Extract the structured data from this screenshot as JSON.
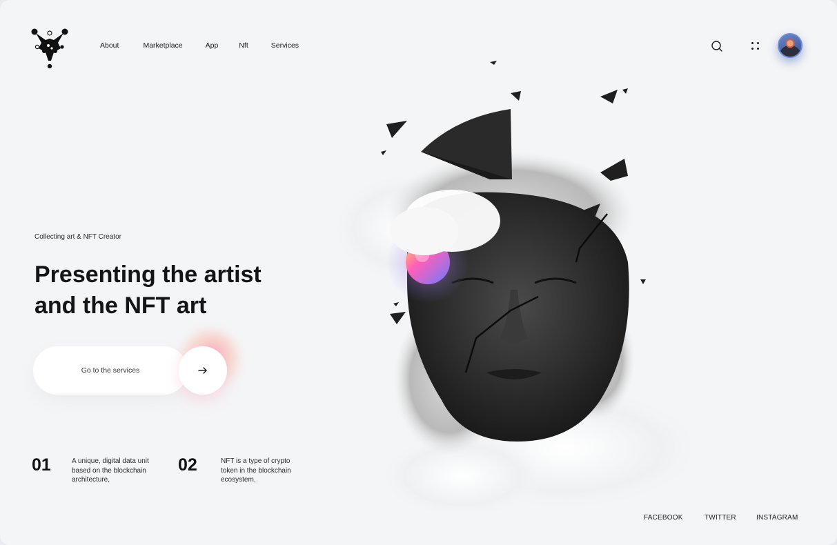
{
  "nav": {
    "items": [
      {
        "label": "About"
      },
      {
        "label": "Marketplace"
      },
      {
        "label": "App"
      },
      {
        "label": "Nft"
      },
      {
        "label": "Services"
      }
    ]
  },
  "header": {
    "search_icon": "search-icon",
    "menu_icon": "grid-dots-icon",
    "avatar": "user-avatar"
  },
  "hero": {
    "eyebrow": "Collecting art & NFT Creator",
    "title_line1": "Presenting the artist",
    "title_line2": "and the NFT art",
    "cta_label": "Go to the services",
    "cta_icon": "arrow-right-icon"
  },
  "stats": [
    {
      "number": "01",
      "line1": "A unique, digital data unit",
      "line2": "based on the blockchain",
      "line3": "architecture,"
    },
    {
      "number": "02",
      "line1": "NFT is a type of crypto",
      "line2": "token in the blockchain",
      "line3": "ecosystem."
    }
  ],
  "socials": [
    {
      "label": "FACEBOOK"
    },
    {
      "label": "TWITTER"
    },
    {
      "label": "INSTAGRAM"
    }
  ],
  "colors": {
    "background": "#f4f5f7",
    "text": "#151515",
    "accent_pink": "#ff6f91",
    "accent_blue": "#6b8bd6"
  }
}
